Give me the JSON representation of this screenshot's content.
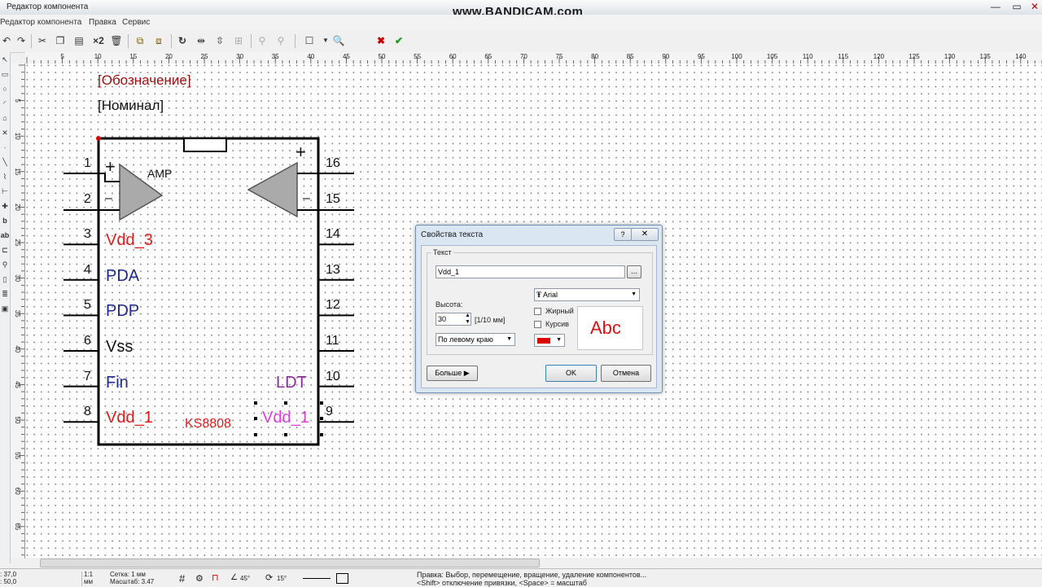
{
  "window": {
    "title": "Редактор компонента",
    "minimize": "—",
    "maximize": "▭",
    "close": "✕"
  },
  "watermark": "www.BANDICAM.com",
  "menu": {
    "items": [
      "Редактор компонента",
      "Правка",
      "Сервис"
    ]
  },
  "toolbar": {
    "multiplier_label": "×2",
    "icons": [
      "undo-icon",
      "redo-icon",
      "cut-icon",
      "copy-icon",
      "paste-icon",
      "duplicate-icon",
      "delete-icon",
      "group-icon",
      "ungroup-icon",
      "rotate-icon",
      "mirror-h-icon",
      "mirror-v-icon",
      "lock-icon",
      "unlock-icon",
      "rectangle-icon",
      "dropdown-icon",
      "zoom-icon",
      "cancel-icon",
      "apply-icon"
    ]
  },
  "ruler": {
    "h_labels": [
      "5",
      "10",
      "15",
      "20",
      "25",
      "30",
      "35",
      "40",
      "45",
      "50",
      "55",
      "60",
      "65",
      "70",
      "75",
      "80",
      "85",
      "90",
      "95",
      "100",
      "105",
      "110",
      "115",
      "120",
      "125",
      "130",
      "135",
      "140"
    ],
    "v_labels": [
      "5",
      "10",
      "15",
      "20",
      "25",
      "30",
      "35",
      "40",
      "45",
      "50",
      "55",
      "60",
      "65",
      "70"
    ]
  },
  "component": {
    "designator": "[Обозначение]",
    "nominal": "[Номинал]",
    "amp_label": "AMP",
    "part_name": "KS8808",
    "plus": "+",
    "minus": "–",
    "pins_left": [
      {
        "num": "1",
        "name": "",
        "color": "#111111"
      },
      {
        "num": "2",
        "name": "",
        "color": "#111111"
      },
      {
        "num": "3",
        "name": "Vdd_3",
        "color": "#e41b1b"
      },
      {
        "num": "4",
        "name": "PDA",
        "color": "#1f2a8c"
      },
      {
        "num": "5",
        "name": "PDP",
        "color": "#1f2a8c"
      },
      {
        "num": "6",
        "name": "Vss",
        "color": "#111111"
      },
      {
        "num": "7",
        "name": "Fin",
        "color": "#1f2a8c"
      },
      {
        "num": "8",
        "name": "Vdd_1",
        "color": "#e41b1b"
      }
    ],
    "pins_right": [
      {
        "num": "16",
        "name": "",
        "color": "#111111"
      },
      {
        "num": "15",
        "name": "",
        "color": "#111111"
      },
      {
        "num": "14",
        "name": "",
        "color": "#111111"
      },
      {
        "num": "13",
        "name": "",
        "color": "#111111"
      },
      {
        "num": "12",
        "name": "",
        "color": "#111111"
      },
      {
        "num": "11",
        "name": "",
        "color": "#111111"
      },
      {
        "num": "10",
        "name": "LDT",
        "color": "#8a2a9c"
      },
      {
        "num": "9",
        "name": "Vdd_1",
        "color": "#e040e0"
      }
    ]
  },
  "dialog": {
    "title": "Свойства текста",
    "help": "?",
    "close": "✕",
    "group_label": "Текст",
    "text_value": "Vdd_1",
    "browse": "...",
    "font_value": "Arial",
    "height_label": "Высота:",
    "height_value": "30",
    "height_unit": "[1/10 мм]",
    "align_value": "По левому краю",
    "bold_label": "Жирный",
    "bold_checked": false,
    "italic_label": "Курсив",
    "italic_checked": false,
    "color_value": "#dd0000",
    "preview": "Abc",
    "more_button": "Больше ▶",
    "ok_button": "OK",
    "cancel_button": "Отмена"
  },
  "status": {
    "coords": ": 37,0\n: 50,0",
    "scale_ratio": "1:1",
    "scale_unit": "мм",
    "grid": "Сетка: 1 мм",
    "zoom": "Масштаб:  3.47",
    "angle1": "45°",
    "angle2": "15°",
    "hint1": "Правка: Выбор, перемещение, вращение, удаление компонентов...",
    "hint2": "<Shift> отключение привязки, <Space> = масштаб"
  }
}
